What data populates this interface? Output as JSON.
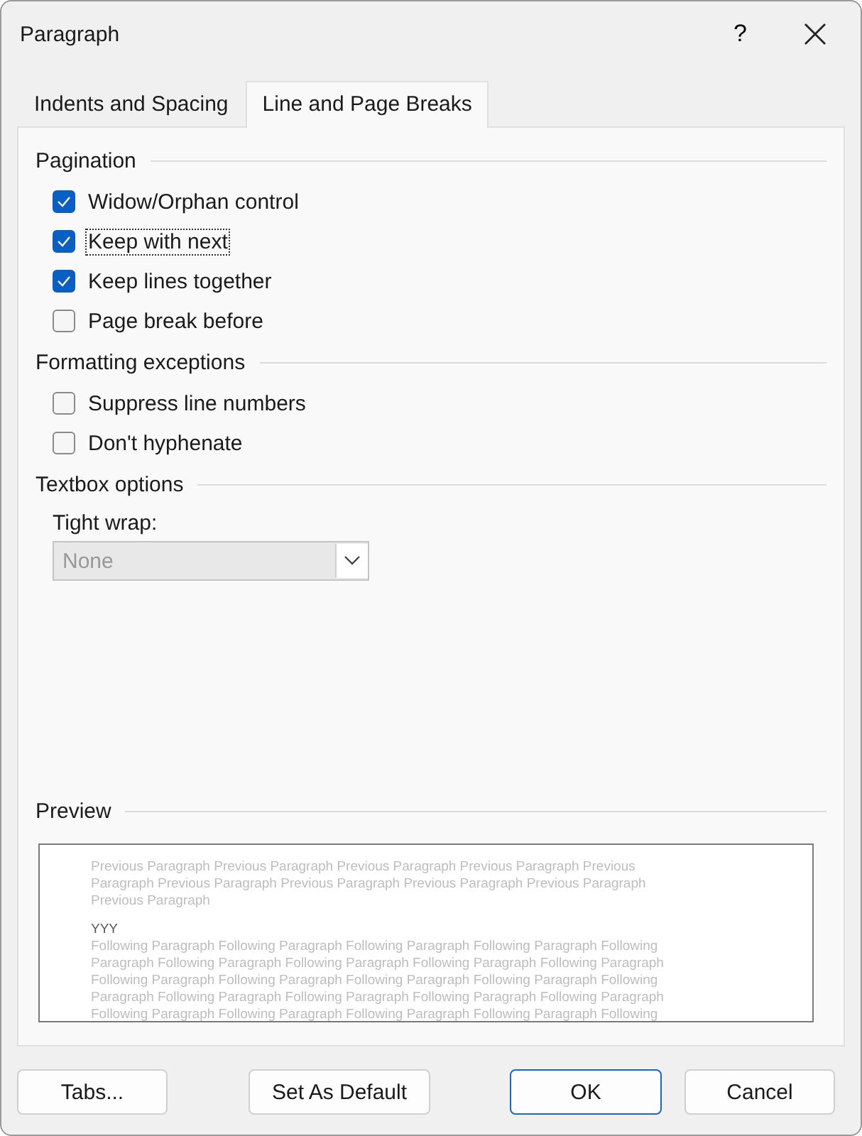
{
  "window": {
    "title": "Paragraph",
    "help": "?"
  },
  "tabs": [
    {
      "label": "Indents and Spacing",
      "selected": false
    },
    {
      "label": "Line and Page Breaks",
      "selected": true
    }
  ],
  "sections": [
    {
      "title": "Pagination",
      "checkboxes": [
        {
          "label": "Widow/Orphan control",
          "checked": true,
          "focused": false
        },
        {
          "label": "Keep with next",
          "checked": true,
          "focused": true
        },
        {
          "label": "Keep lines together",
          "checked": true,
          "focused": false
        },
        {
          "label": "Page break before",
          "checked": false,
          "focused": false
        }
      ]
    },
    {
      "title": "Formatting exceptions",
      "checkboxes": [
        {
          "label": "Suppress line numbers",
          "checked": false,
          "focused": false
        },
        {
          "label": "Don't hyphenate",
          "checked": false,
          "focused": false
        }
      ]
    }
  ],
  "textbox_options": {
    "title": "Textbox options",
    "tight_wrap": {
      "label": "Tight wrap:",
      "value": "None",
      "disabled": true
    }
  },
  "preview": {
    "title": "Preview",
    "previous_lines": [
      "Previous Paragraph Previous Paragraph Previous Paragraph Previous Paragraph Previous",
      "Paragraph Previous Paragraph Previous Paragraph Previous Paragraph Previous Paragraph",
      "Previous Paragraph"
    ],
    "current_text": "YYY",
    "following_lines": [
      "Following Paragraph Following Paragraph Following Paragraph Following Paragraph Following",
      "Paragraph Following Paragraph Following Paragraph Following Paragraph Following Paragraph",
      "Following Paragraph Following Paragraph Following Paragraph Following Paragraph Following",
      "Paragraph Following Paragraph Following Paragraph Following Paragraph Following Paragraph",
      "Following Paragraph Following Paragraph Following Paragraph Following Paragraph Following"
    ]
  },
  "buttons": [
    {
      "label": "Tabs...",
      "default": false
    },
    {
      "label": "Set As Default",
      "default": false
    },
    {
      "label": "OK",
      "default": true
    },
    {
      "label": "Cancel",
      "default": false
    }
  ]
}
